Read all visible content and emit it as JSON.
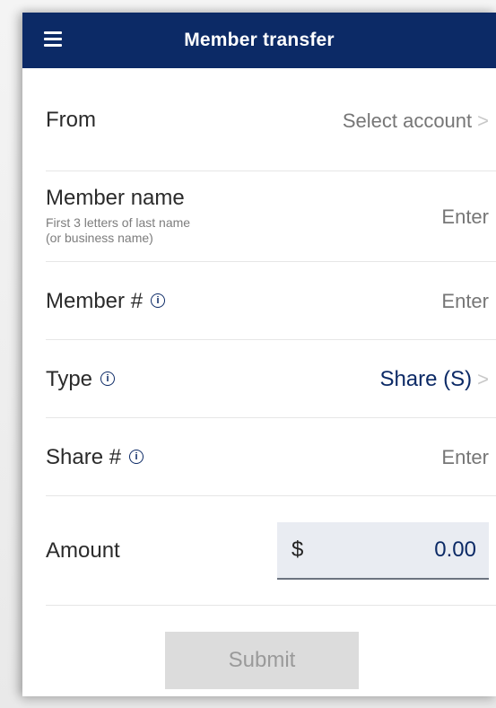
{
  "header": {
    "title": "Member transfer",
    "menu_icon": "hamburger-menu-icon"
  },
  "form": {
    "from": {
      "label": "From",
      "value": "Select account",
      "chevron": ">"
    },
    "member_name": {
      "label": "Member name",
      "hint_line1": "First 3 letters of last name",
      "hint_line2": "(or business name)",
      "value": "Enter"
    },
    "member_number": {
      "label": "Member #",
      "info_icon": "i",
      "value": "Enter"
    },
    "type": {
      "label": "Type",
      "info_icon": "i",
      "value": "Share (S)",
      "chevron": ">"
    },
    "share_number": {
      "label": "Share #",
      "info_icon": "i",
      "value": "Enter"
    },
    "amount": {
      "label": "Amount",
      "currency": "$",
      "value": "0.00"
    }
  },
  "actions": {
    "submit_label": "Submit"
  },
  "colors": {
    "nav_bg": "#0c2a66",
    "accent": "#0c2a66",
    "submit_disabled_bg": "#dcdcdc"
  }
}
